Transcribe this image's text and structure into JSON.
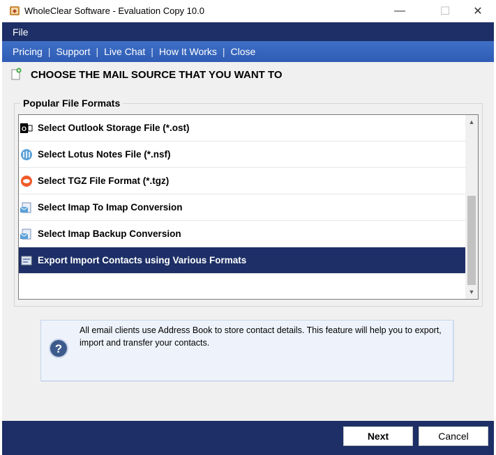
{
  "window": {
    "title": "WholeClear Software - Evaluation Copy 10.0",
    "minimize_glyph": "—",
    "maximize_glyph": "☐",
    "close_glyph": "✕"
  },
  "menu": {
    "file_label": "File"
  },
  "nav": {
    "links": [
      "Pricing",
      "Support",
      "Live Chat",
      "How It Works",
      "Close"
    ],
    "separator": "|"
  },
  "heading": "CHOOSE THE MAIL SOURCE THAT YOU WANT TO",
  "group": {
    "legend": "Popular File Formats",
    "items": [
      {
        "label": "Select Outlook Storage File (*.ost)",
        "icon": "outlook-icon"
      },
      {
        "label": "Select Lotus Notes File (*.nsf)",
        "icon": "lotus-notes-icon"
      },
      {
        "label": "Select TGZ File Format (*.tgz)",
        "icon": "tgz-icon"
      },
      {
        "label": "Select Imap To Imap Conversion",
        "icon": "imap-icon"
      },
      {
        "label": "Select Imap Backup Conversion",
        "icon": "imap-backup-icon"
      },
      {
        "label": "Export Import Contacts using Various Formats",
        "icon": "contacts-icon",
        "selected": true
      }
    ]
  },
  "info": {
    "text": "All email clients use Address Book to store contact details. This feature will help you to export, import and transfer your contacts.",
    "icon": "help-icon"
  },
  "footer": {
    "next_label": "Next",
    "cancel_label": "Cancel"
  },
  "colors": {
    "menubar": "#1d2f66",
    "navbar": "#3f6fc6",
    "selection": "#1d2f66",
    "info_bg": "#eef3fb"
  }
}
